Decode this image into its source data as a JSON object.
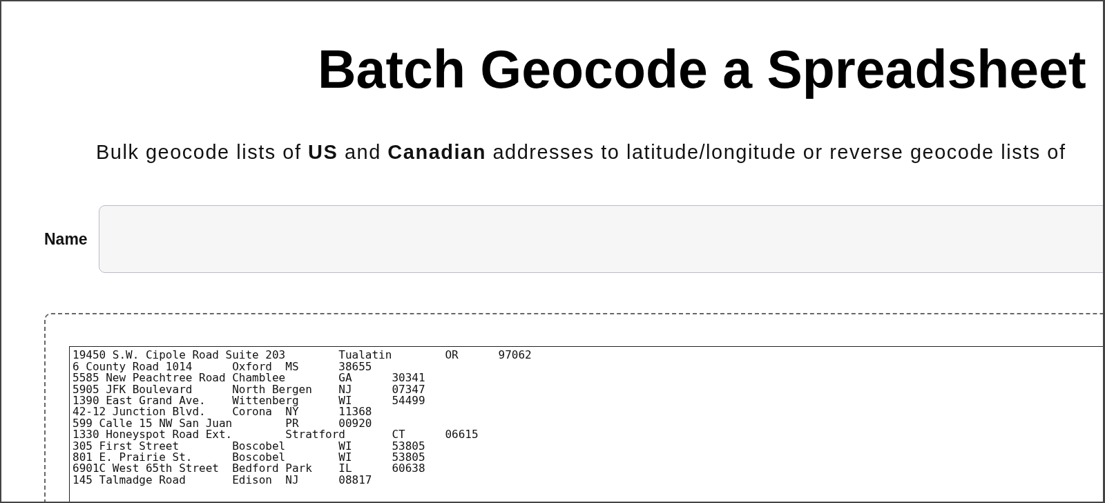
{
  "title": "Batch Geocode a Spreadsheet",
  "subtitle": "Bulk geocode lists of **US** and **Canadian** addresses to latitude/longitude or reverse geocode lists of",
  "name_field": {
    "label": "Name"
  },
  "addresses": [
    "19450 S.W. Cipole Road Suite 203        Tualatin        OR      97062",
    "6 County Road 1014      Oxford  MS      38655",
    "5585 New Peachtree Road Chamblee        GA      30341",
    "5905 JFK Boulevard      North Bergen    NJ      07347",
    "1390 East Grand Ave.    Wittenberg      WI      54499",
    "42-12 Junction Blvd.    Corona  NY      11368",
    "599 Calle 15 NW San Juan        PR      00920",
    "1330 Honeyspot Road Ext.        Stratford       CT      06615",
    "305 First Street        Boscobel        WI      53805",
    "801 E. Prairie St.      Boscobel        WI      53805",
    "6901C West 65th Street  Bedford Park    IL      60638",
    "145 Talmadge Road       Edison  NJ      08817"
  ]
}
